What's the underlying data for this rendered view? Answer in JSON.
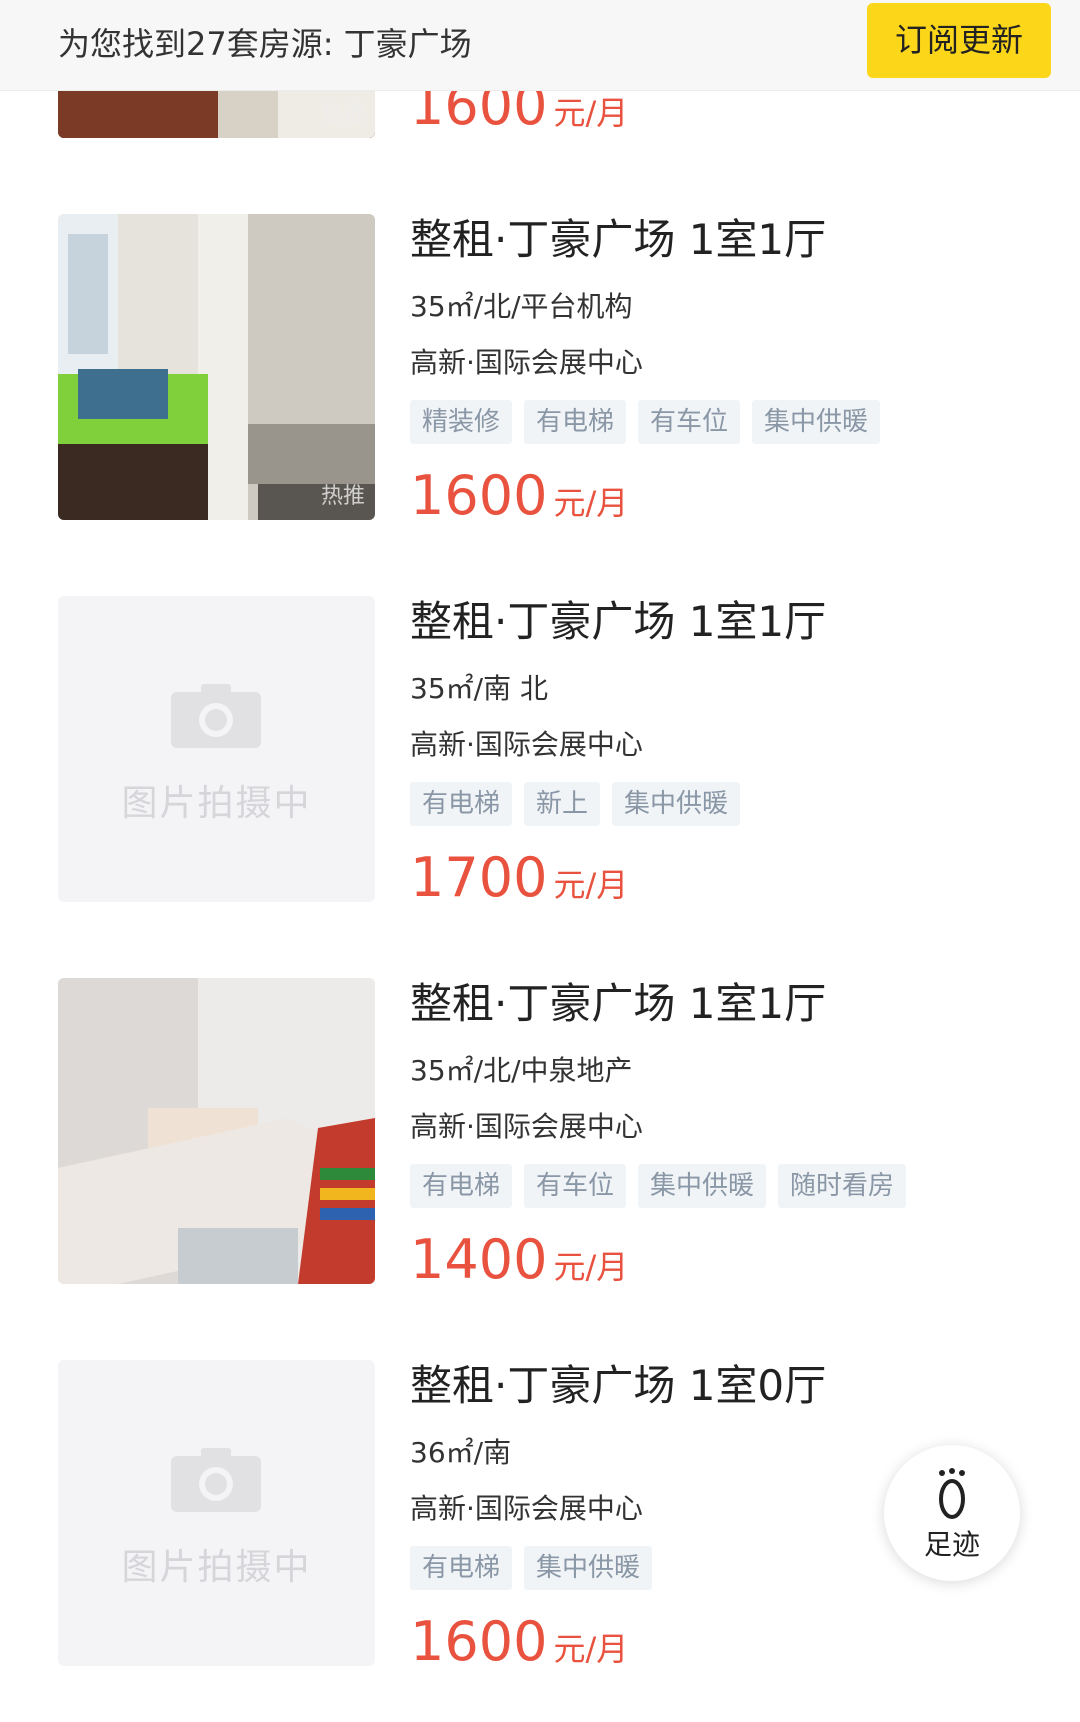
{
  "header": {
    "result_text": "为您找到27套房源: 丁豪广场",
    "subscribe_label": "订阅更新"
  },
  "hot_label": "热推",
  "placeholder_text": "图片拍摄中",
  "price_unit": "元/月",
  "listings": [
    {
      "title": "",
      "spec": "",
      "location": "",
      "tags": [],
      "price": "1600",
      "photo": "room-brown",
      "hot": true
    },
    {
      "title": "整租·丁豪广场 1室1厅",
      "spec": "35㎡/北/平台机构",
      "location": "高新·国际会展中心",
      "tags": [
        "精装修",
        "有电梯",
        "有车位",
        "集中供暖"
      ],
      "price": "1600",
      "photo": "room-green",
      "hot": true
    },
    {
      "title": "整租·丁豪广场 1室1厅",
      "spec": "35㎡/南 北",
      "location": "高新·国际会展中心",
      "tags": [
        "有电梯",
        "新上",
        "集中供暖"
      ],
      "price": "1700",
      "photo": "placeholder",
      "hot": false
    },
    {
      "title": "整租·丁豪广场 1室1厅",
      "spec": "35㎡/北/中泉地产",
      "location": "高新·国际会展中心",
      "tags": [
        "有电梯",
        "有车位",
        "集中供暖",
        "随时看房"
      ],
      "price": "1400",
      "photo": "room-bed",
      "hot": false
    },
    {
      "title": "整租·丁豪广场 1室0厅",
      "spec": "36㎡/南",
      "location": "高新·国际会展中心",
      "tags": [
        "有电梯",
        "集中供暖"
      ],
      "price": "1600",
      "photo": "placeholder",
      "hot": false
    }
  ],
  "fab": {
    "label": "足迹",
    "icon": "footprint-icon"
  },
  "colors": {
    "accent": "#fbd619",
    "price": "#e8523f",
    "tag_bg": "#f1f4f7",
    "tag_text": "#8a97a6"
  }
}
